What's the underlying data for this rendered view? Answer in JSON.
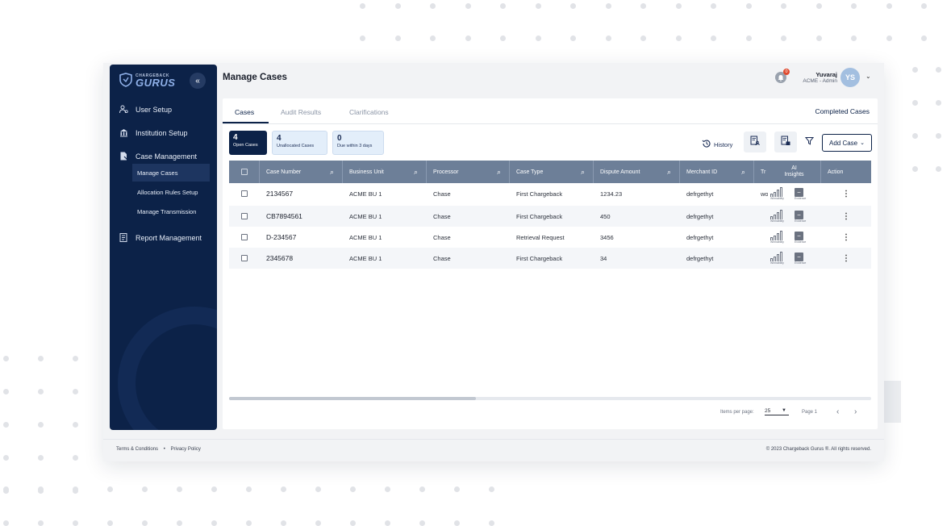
{
  "app": {
    "logo_small": "CHARGEBACK",
    "logo_big": "GURUS",
    "collapse_icon": "double-chevron-left-icon"
  },
  "sidebar": {
    "items": [
      {
        "label": "User Setup",
        "icon": "user-gear-icon"
      },
      {
        "label": "Institution Setup",
        "icon": "bank-icon"
      },
      {
        "label": "Case Management",
        "icon": "case-file-icon"
      },
      {
        "label": "Report Management",
        "icon": "report-icon"
      }
    ],
    "sub_items": [
      {
        "label": "Manage Cases",
        "active": true
      },
      {
        "label": "Allocation Rules Setup",
        "active": false
      },
      {
        "label": "Manage Transmission",
        "active": false
      }
    ]
  },
  "header": {
    "title": "Manage Cases",
    "notification_count": "0",
    "user_name": "Yuvaraj",
    "user_role": "ACME - Admin",
    "avatar_initials": "YS"
  },
  "tabs": {
    "items": [
      "Cases",
      "Audit Results",
      "Clarifications"
    ],
    "active": "Cases",
    "completed_link": "Completed Cases"
  },
  "stats": [
    {
      "value": "4",
      "label": "Open Cases"
    },
    {
      "value": "4",
      "label": "Unallocated Cases"
    },
    {
      "value": "0",
      "label": "Due within 3 days"
    }
  ],
  "toolbar": {
    "history_label": "History",
    "add_case_label": "Add Case"
  },
  "table": {
    "columns": [
      "Case Number",
      "Business Unit",
      "Processor",
      "Case Type",
      "Dispute Amount",
      "Merchant ID",
      "Tr",
      "AI Insights",
      "Action"
    ],
    "ai_insight_labels": {
      "winnability": "Winnability",
      "evidence": "Evidence"
    },
    "rows": [
      {
        "case_number": "2134567",
        "business_unit": "ACME BU 1",
        "processor": "Chase",
        "case_type": "First Chargeback",
        "dispute_amount": "1234.23",
        "merchant_id": "defrgethyt",
        "tr": "wo"
      },
      {
        "case_number": "CB7894561",
        "business_unit": "ACME BU 1",
        "processor": "Chase",
        "case_type": "First Chargeback",
        "dispute_amount": "450",
        "merchant_id": "defrgethyt",
        "tr": ""
      },
      {
        "case_number": "D-234567",
        "business_unit": "ACME BU 1",
        "processor": "Chase",
        "case_type": "Retrieval Request",
        "dispute_amount": "3456",
        "merchant_id": "defrgethyt",
        "tr": ""
      },
      {
        "case_number": "2345678",
        "business_unit": "ACME BU 1",
        "processor": "Chase",
        "case_type": "First Chargeback",
        "dispute_amount": "34",
        "merchant_id": "defrgethyt",
        "tr": ""
      }
    ]
  },
  "pagination": {
    "items_per_page_label": "Items per page:",
    "items_per_page_value": "25",
    "page_label": "Page 1"
  },
  "footer": {
    "terms": "Terms & Conditions",
    "privacy": "Privacy Policy",
    "copyright": "© 2023 Chargeback Gurus ®. All rights reserved."
  }
}
